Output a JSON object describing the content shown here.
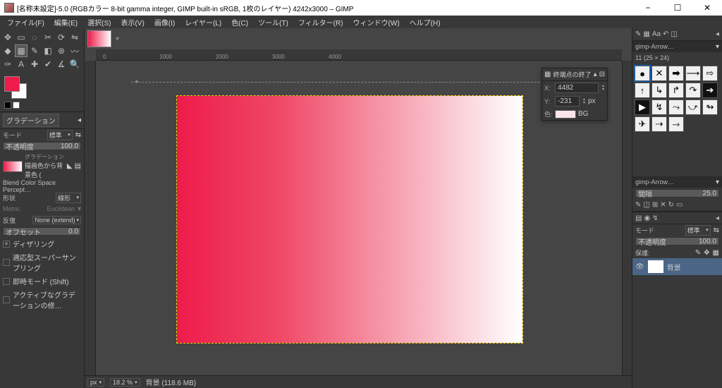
{
  "window": {
    "title": "[名称未設定]-5.0 (RGBカラー 8-bit gamma integer, GIMP built-in sRGB, 1枚のレイヤー) 4242x3000 – GIMP"
  },
  "menu": [
    "ファイル(F)",
    "編集(E)",
    "選択(S)",
    "表示(V)",
    "画像(I)",
    "レイヤー(L)",
    "色(C)",
    "ツール(T)",
    "フィルター(R)",
    "ウィンドウ(W)",
    "ヘルプ(H)"
  ],
  "tool_options": {
    "panel": "グラデーション",
    "mode_label": "モード",
    "mode_value": "標準",
    "opacity_label": "不透明度",
    "opacity_value": "100.0",
    "gradient_label": "グラデーション",
    "gradient_name": "描画色から背景色 (",
    "blend_label": "Blend Color Space Percept…",
    "shape_label": "形状",
    "shape_value": "線形",
    "metric_label": "Metric",
    "metric_value": "Euclidean",
    "repeat_label": "反復",
    "repeat_value": "None (extend)",
    "offset_label": "オフセット",
    "offset_value": "0.0",
    "dither": "ディザリング",
    "supersample": "適応型スーパーサンプリング",
    "instant": "即時モード (Shift)",
    "active_grad": "アクティブなグラデーションの修…"
  },
  "float_panel": {
    "title": "終端点の終了",
    "x": "4482",
    "y": "-231",
    "unit": "px",
    "color_label": "色:",
    "bg": "BG"
  },
  "right": {
    "brush_name": "gimp-Arrow…",
    "brush_dim": "11 (25 × 24)",
    "spacing_label": "間隔",
    "spacing_value": "25.0",
    "layer_mode_label": "モード",
    "layer_mode": "標準",
    "layer_opacity_label": "不透明度",
    "layer_opacity": "100.0",
    "lock_label": "保護:",
    "layer_name": "背景"
  },
  "status": {
    "unit": "px",
    "zoom": "18.2 %",
    "info": "背景 (118.6 MB)"
  },
  "ruler_ticks": [
    "0",
    "1000",
    "2000",
    "3000",
    "4000"
  ]
}
